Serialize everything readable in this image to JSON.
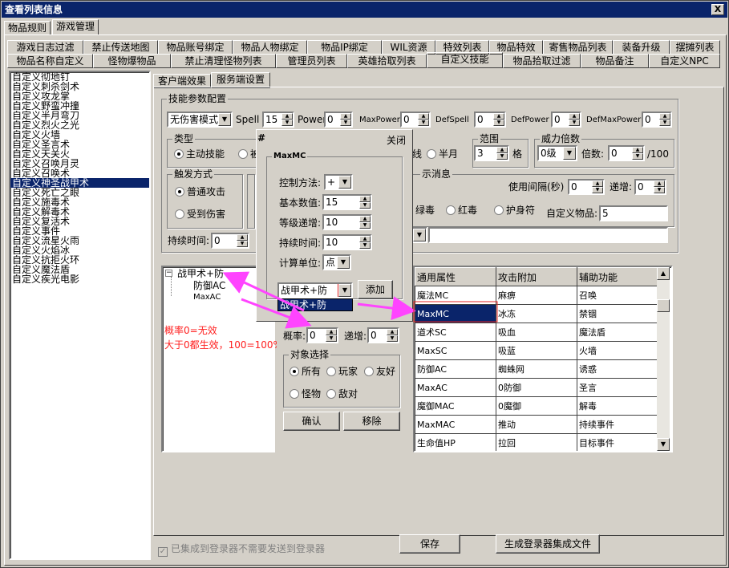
{
  "window": {
    "title": "查看列表信息",
    "close": "X"
  },
  "top_tabs": [
    "物品规则",
    "游戏管理"
  ],
  "tab_row1": [
    "游戏日志过滤",
    "禁止传送地图",
    "物品账号绑定",
    "物品人物绑定",
    "物品IP绑定",
    "WIL资源",
    "特效列表",
    "物品特效",
    "寄售物品列表",
    "装备升级",
    "摆摊列表"
  ],
  "tab_row2": [
    "物品名称自定义",
    "怪物爆物品",
    "禁止清理怪物列表",
    "管理员列表",
    "英雄拾取列表",
    "自定义技能",
    "物品拾取过滤",
    "物品备注",
    "自定义NPC"
  ],
  "skill_list": {
    "items": [
      "自定义彻地钉",
      "自定义刺杀剑术",
      "自定义攻龙掌",
      "自定义野蛮冲撞",
      "自定义半月弯刀",
      "自定义烈火之光",
      "自定义火墙",
      "自定义圣言术",
      "自定义天关火",
      "自定义召唤月灵",
      "自定义召唤术",
      "自定义神圣战甲术",
      "自定义死亡之眼",
      "自定义施毒术",
      "自定义解毒术",
      "自定义复活术",
      "自定义事件",
      "自定义流星火雨",
      "自定义火焰冰",
      "自定义抗拒火环",
      "自定义魔法盾",
      "自定义疾光电影"
    ],
    "selected_index": 11
  },
  "sub_tabs": [
    "客户端效果",
    "服务端设置"
  ],
  "params": {
    "title": "技能参数配置",
    "damage_mode": "无伤害模式",
    "spell_label": "Spell",
    "spell": "15",
    "power_label": "Power",
    "power": "0",
    "maxpower_label": "MaxPower",
    "maxpower": "0",
    "defspell_label": "DefSpell",
    "defspell": "0",
    "defpower_label": "DefPower",
    "defpower": "0",
    "defmaxpower_label": "DefMaxPower",
    "defmaxpower": "0"
  },
  "type_group": {
    "title": "类型",
    "opt1": "主动技能",
    "opt2": "被",
    "opt3": "线",
    "opt4": "半月"
  },
  "range_group": {
    "title": "范围",
    "value": "3",
    "unit": "格"
  },
  "power_mult": {
    "title": "威力倍数",
    "level": "0级",
    "mult_label": "倍数:",
    "mult": "0",
    "max": "/100"
  },
  "trigger": {
    "title": "触发方式",
    "opt1": "普通攻击",
    "opt2": "受到伤害",
    "duration_label": "持续时间:",
    "duration": "0"
  },
  "msg_group": {
    "title": "示消息",
    "interval_label": "使用间隔(秒)",
    "interval": "0",
    "inc_label": "递增:",
    "inc": "0",
    "poison1": "绿毒",
    "poison2": "红毒",
    "amulet": "护身符",
    "item_label": "自定义物品:",
    "item": "5"
  },
  "popup": {
    "hash": "#",
    "close": "关闭",
    "group": "MaxMC",
    "method_label": "控制方法:",
    "method": "+",
    "base_label": "基本数值:",
    "base": "15",
    "level_label": "等级递增:",
    "level": "10",
    "dur_label": "持续时间:",
    "dur": "10",
    "unit_label": "计算单位:",
    "unit": "点",
    "combo": "战甲术+防",
    "combo_option": "战甲术+防",
    "add": "添加"
  },
  "tree": {
    "root": "战甲术+防",
    "children": [
      "防御AC",
      "MaxAC"
    ],
    "toggle": "−"
  },
  "note": [
    "概率0=无效",
    "大于0都生效，100=100%"
  ],
  "prob": {
    "prob_label": "概率:",
    "prob": "0",
    "inc_label": "递增:",
    "inc": "0"
  },
  "target": {
    "title": "对象选择",
    "all": "所有",
    "player": "玩家",
    "friend": "友好",
    "monster": "怪物",
    "enemy": "敌对"
  },
  "buttons": {
    "confirm": "确认",
    "remove": "移除",
    "save": "保存",
    "gen": "生成登录器集成文件"
  },
  "grid": {
    "headers": [
      "通用属性",
      "攻击附加",
      "辅助功能"
    ],
    "rows": [
      [
        "魔法MC",
        "麻痹",
        "召唤"
      ],
      [
        "MaxMC",
        "冰冻",
        "禁锢"
      ],
      [
        "道术SC",
        "吸血",
        "魔法盾"
      ],
      [
        "MaxSC",
        "吸蓝",
        "火墙"
      ],
      [
        "防御AC",
        "蜘蛛网",
        "诱惑"
      ],
      [
        "MaxAC",
        "0防御",
        "圣言"
      ],
      [
        "魔御MAC",
        "0魔御",
        "解毒"
      ],
      [
        "MaxMAC",
        "推动",
        "持续事件"
      ],
      [
        "生命值HP",
        "拉回",
        "目标事件"
      ]
    ],
    "selected_row": 1
  },
  "footer": {
    "integrated": "已集成到登录器不需要发送到登录器"
  },
  "colors": {
    "title_bg": "#0a246a",
    "face": "#d4d0c8",
    "arrow": "#ff44ff",
    "note": "#ff2020",
    "outline": "#e02020"
  }
}
